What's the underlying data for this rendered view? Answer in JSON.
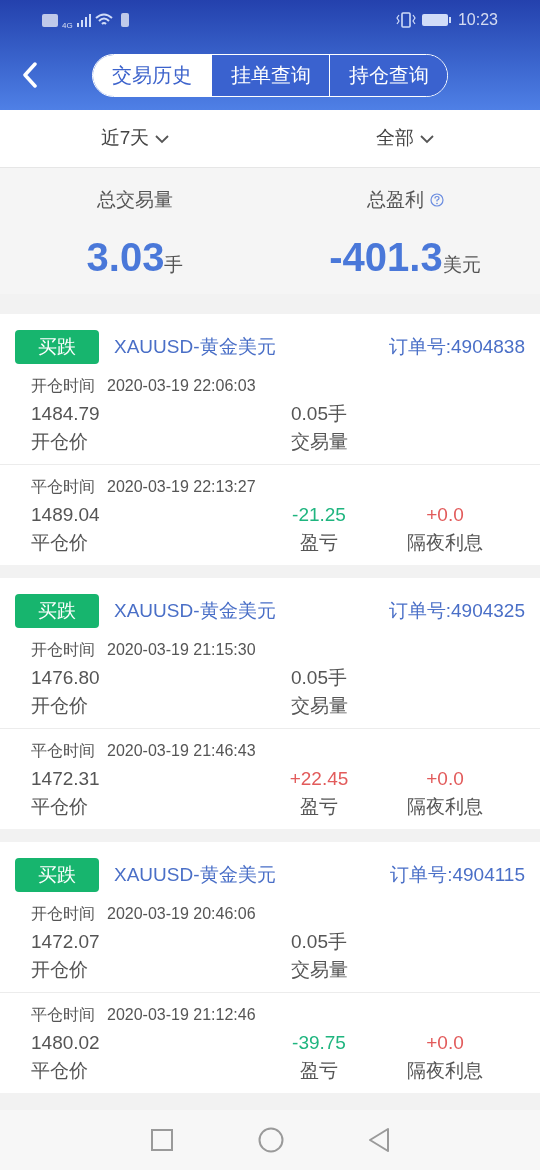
{
  "status_bar": {
    "time": "10:23",
    "network": "4G"
  },
  "tabs": [
    {
      "label": "交易历史",
      "selected": true
    },
    {
      "label": "挂单查询",
      "selected": false
    },
    {
      "label": "持仓查询",
      "selected": false
    }
  ],
  "filters": [
    {
      "label": "近7天"
    },
    {
      "label": "全部"
    }
  ],
  "summary": [
    {
      "label": "总交易量",
      "value": "3.03",
      "unit": "手",
      "help": false
    },
    {
      "label": "总盈利",
      "value": "-401.3",
      "unit": "美元",
      "help": true
    }
  ],
  "orders": [
    {
      "side": "买跌",
      "symbol": "XAUUSD-黄金美元",
      "order_no": "订单号:4904838",
      "open_time_label": "开仓时间",
      "open_time": "2020-03-19 22:06:03",
      "open_price": "1484.79",
      "open_price_label": "开仓价",
      "volume": "0.05手",
      "volume_label": "交易量",
      "close_time_label": "平仓时间",
      "close_time": "2020-03-19 22:13:27",
      "close_price": "1489.04",
      "close_price_label": "平仓价",
      "profit": {
        "text": "-21.25",
        "color": "#1fb57f"
      },
      "profit_label": "盈亏",
      "swap": {
        "text": "+0.0",
        "color": "#e25b5b"
      },
      "swap_label": "隔夜利息"
    },
    {
      "side": "买跌",
      "symbol": "XAUUSD-黄金美元",
      "order_no": "订单号:4904325",
      "open_time_label": "开仓时间",
      "open_time": "2020-03-19 21:15:30",
      "open_price": "1476.80",
      "open_price_label": "开仓价",
      "volume": "0.05手",
      "volume_label": "交易量",
      "close_time_label": "平仓时间",
      "close_time": "2020-03-19 21:46:43",
      "close_price": "1472.31",
      "close_price_label": "平仓价",
      "profit": {
        "text": "+22.45",
        "color": "#e25b5b"
      },
      "profit_label": "盈亏",
      "swap": {
        "text": "+0.0",
        "color": "#e25b5b"
      },
      "swap_label": "隔夜利息"
    },
    {
      "side": "买跌",
      "symbol": "XAUUSD-黄金美元",
      "order_no": "订单号:4904115",
      "open_time_label": "开仓时间",
      "open_time": "2020-03-19 20:46:06",
      "open_price": "1472.07",
      "open_price_label": "开仓价",
      "volume": "0.05手",
      "volume_label": "交易量",
      "close_time_label": "平仓时间",
      "close_time": "2020-03-19 21:12:46",
      "close_price": "1480.02",
      "close_price_label": "平仓价",
      "profit": {
        "text": "-39.75",
        "color": "#1fb57f"
      },
      "profit_label": "盈亏",
      "swap": {
        "text": "+0.0",
        "color": "#e25b5b"
      },
      "swap_label": "隔夜利息"
    }
  ]
}
